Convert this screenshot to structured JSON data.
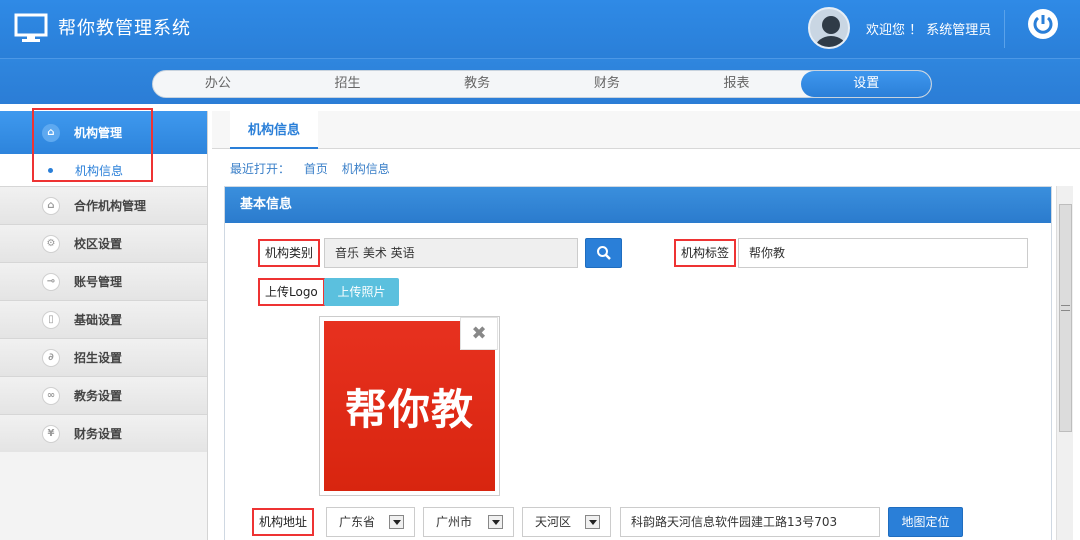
{
  "header": {
    "title": "帮你教管理系统",
    "welcome": "欢迎您 ！ 系统管理员",
    "icons": {
      "logo": "monitor-icon",
      "avatar": "user-avatar",
      "power": "power-icon"
    }
  },
  "nav": {
    "tabs": [
      {
        "label": "办公"
      },
      {
        "label": "招生"
      },
      {
        "label": "教务"
      },
      {
        "label": "财务"
      },
      {
        "label": "报表"
      },
      {
        "label": "设置",
        "active": true
      }
    ]
  },
  "sidebar": {
    "head": {
      "label": "机构管理",
      "icon": "home-icon"
    },
    "sub": {
      "label": "机构信息"
    },
    "items": [
      {
        "label": "合作机构管理",
        "icon": "home-icon"
      },
      {
        "label": "校区设置",
        "icon": "gear-icon"
      },
      {
        "label": "账号管理",
        "icon": "key-icon"
      },
      {
        "label": "基础设置",
        "icon": "document-icon"
      },
      {
        "label": "招生设置",
        "icon": "paperclip-icon"
      },
      {
        "label": "教务设置",
        "icon": "link-icon"
      },
      {
        "label": "财务设置",
        "icon": "yen-icon"
      }
    ]
  },
  "content": {
    "tab": "机构信息",
    "recent_label": "最近打开：",
    "recent_links": [
      "首页",
      "机构信息"
    ],
    "panel_title": "基本信息",
    "form": {
      "category_label": "机构类别",
      "category_value": "音乐 美术 英语",
      "tag_label": "机构标签",
      "tag_value": "帮你教",
      "logo_label": "上传Logo",
      "upload_button": "上传照片",
      "logo_text": "帮你教",
      "close_symbol": "✖",
      "address_label": "机构地址",
      "province": "广东省",
      "city": "广州市",
      "district": "天河区",
      "street": "科韵路天河信息软件园建工路13号703",
      "map_button": "地图定位"
    }
  },
  "colors": {
    "primary": "#2a7fd8",
    "header_bg": "#2f8ae6",
    "highlight": "#e33333",
    "logo_red": "#e7311f"
  }
}
